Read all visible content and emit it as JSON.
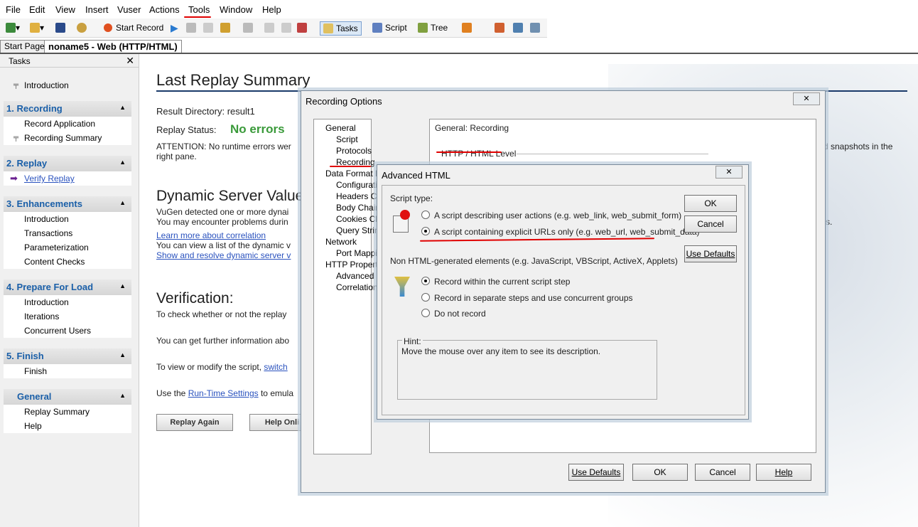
{
  "menu": [
    "File",
    "Edit",
    "View",
    "Insert",
    "Vuser",
    "Actions",
    "Tools",
    "Window",
    "Help"
  ],
  "toolbar": {
    "start_record": "Start Record",
    "tasks": "Tasks",
    "script": "Script",
    "tree": "Tree"
  },
  "doc_tabs": {
    "start": "Start Page",
    "active": "noname5 - Web (HTTP/HTML)"
  },
  "tasks_pane": {
    "title": "Tasks",
    "intro": "Introduction",
    "groups": [
      {
        "title": "1. Recording",
        "items": [
          "Record Application",
          "Recording Summary"
        ]
      },
      {
        "title": "2. Replay",
        "items": [
          "Verify Replay"
        ]
      },
      {
        "title": "3. Enhancements",
        "items": [
          "Introduction",
          "Transactions",
          "Parameterization",
          "Content Checks"
        ]
      },
      {
        "title": "4. Prepare For Load",
        "items": [
          "Introduction",
          "Iterations",
          "Concurrent Users"
        ]
      },
      {
        "title": "5. Finish",
        "items": [
          "Finish"
        ]
      },
      {
        "title": "General",
        "items": [
          "Replay Summary",
          "Help"
        ]
      }
    ]
  },
  "summary": {
    "title": "Last Replay Summary",
    "result_dir": "Result Directory: result1",
    "replay_status_label": "Replay Status:",
    "replay_status_value": "No errors",
    "attention": "ATTENTION: No runtime errors wer",
    "attention2": "right pane.",
    "right_text": "d snapshots in the",
    "dyn_title": "Dynamic Server Value",
    "dyn1": "VuGen detected one or more dynai",
    "dyn2": "You may encounter problems durin",
    "dyn_link1": "Learn more about correlation",
    "dyn3": "You can view a list of the dynamic v",
    "dyn_link2": "Show and resolve dynamic server v",
    "right_text2": "s.",
    "ver_title": "Verification:",
    "ver1": "To check whether or not the replay",
    "ver2": "You can get further information abo",
    "ver3_pre": "To view or modify the script, ",
    "ver3_link": "switch",
    "ver4_pre": "Use the ",
    "ver4_link": "Run-Time Settings",
    "ver4_post": " to emula",
    "btn_replay": "Replay Again",
    "btn_help": "Help Onli"
  },
  "recording_options": {
    "title": "Recording Options",
    "tree": [
      "General",
      "Script",
      "Protocols",
      "Recording",
      "Data Format Ex",
      "Configuratio",
      "Headers Ch",
      "Body Chain",
      "Cookies Ch",
      "Query String",
      "Network",
      "Port Mappin",
      "HTTP Properti",
      "Advanced",
      "Correlation"
    ],
    "panel_title": "General: Recording",
    "level": "HTTP / HTML Level",
    "buttons": {
      "use_defaults": "Use Defaults",
      "ok": "OK",
      "cancel": "Cancel",
      "help": "Help"
    }
  },
  "advanced_html": {
    "title": "Advanced HTML",
    "script_type": "Script type:",
    "opt1": "A script describing user actions (e.g. web_link, web_submit_form)",
    "opt2": "A script containing explicit URLs only (e.g. web_url, web_submit_data)",
    "non_html": "Non HTML-generated elements (e.g. JavaScript, VBScript, ActiveX, Applets)",
    "rec1": "Record within the current script step",
    "rec2": "Record in separate steps and use concurrent groups",
    "rec3": "Do not record",
    "hint_label": "Hint:",
    "hint": "Move the mouse over any item to see its description.",
    "buttons": {
      "ok": "OK",
      "cancel": "Cancel",
      "use_defaults": "Use Defaults"
    }
  }
}
